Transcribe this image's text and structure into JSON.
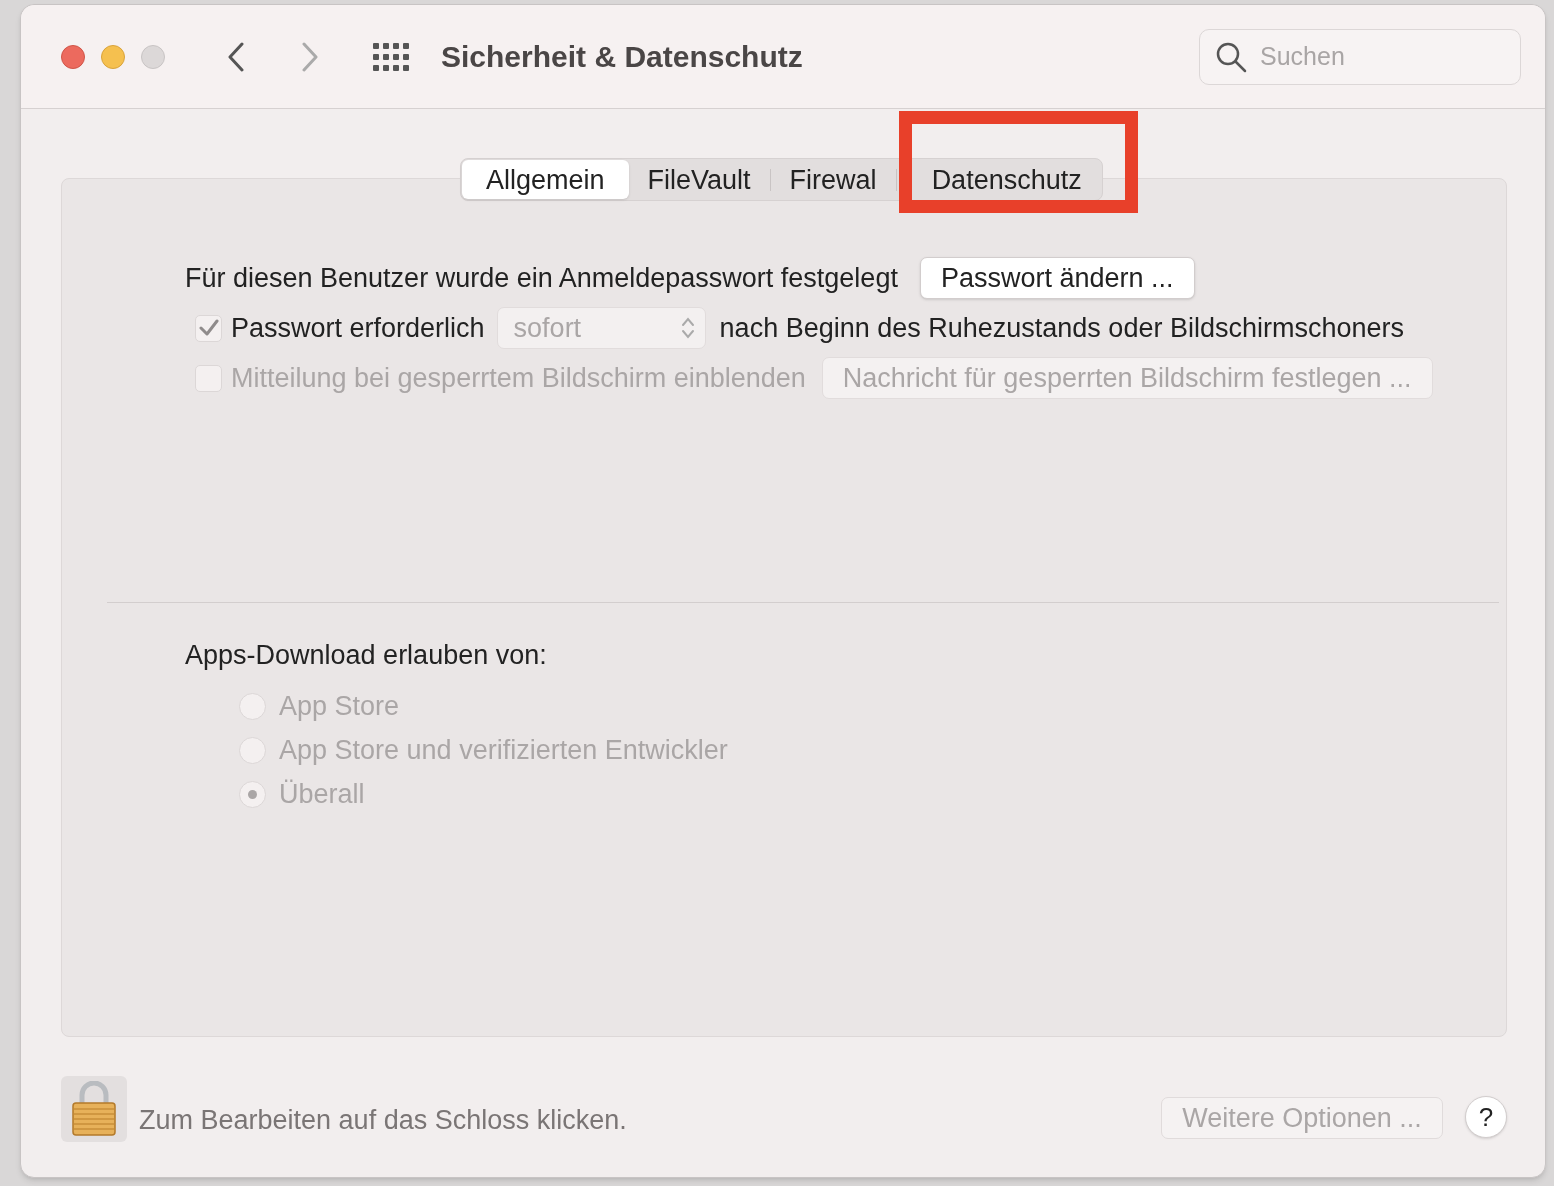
{
  "window": {
    "title": "Sicherheit & Datenschutz",
    "search": {
      "placeholder": "Suchen"
    }
  },
  "tabs": [
    {
      "label": "Allgemein",
      "selected": true,
      "highlighted": false
    },
    {
      "label": "FileVault",
      "selected": false,
      "highlighted": false
    },
    {
      "label": "Firewal",
      "selected": false,
      "highlighted": false
    },
    {
      "label": "Datenschutz",
      "selected": false,
      "highlighted": true
    }
  ],
  "login": {
    "text": "Für diesen Benutzer wurde ein Anmeldepasswort festgelegt",
    "button": "Passwort ändern ..."
  },
  "options": [
    {
      "kind": "popup-row",
      "checked": true,
      "disabled": false,
      "label": "Passwort erforderlich",
      "popup": "sofort",
      "suffix": "nach Beginn des Ruhezustands oder Bildschirmschoners"
    },
    {
      "kind": "button-row",
      "checked": false,
      "disabled": true,
      "label": "Mitteilung bei gesperrtem Bildschirm einblenden",
      "button": "Nachricht für gesperrten Bildschirm festlegen ..."
    }
  ],
  "downloads": {
    "heading": "Apps-Download erlauben von:",
    "choices": [
      {
        "label": "App Store",
        "selected": false,
        "disabled": true
      },
      {
        "label": "App Store und verifizierten Entwickler",
        "selected": false,
        "disabled": true
      },
      {
        "label": "Überall",
        "selected": true,
        "disabled": true
      }
    ]
  },
  "footer": {
    "lock_text": "Zum Bearbeiten auf das Schloss klicken.",
    "more_button": "Weitere Optionen ...",
    "more_disabled": true,
    "help": "?"
  }
}
